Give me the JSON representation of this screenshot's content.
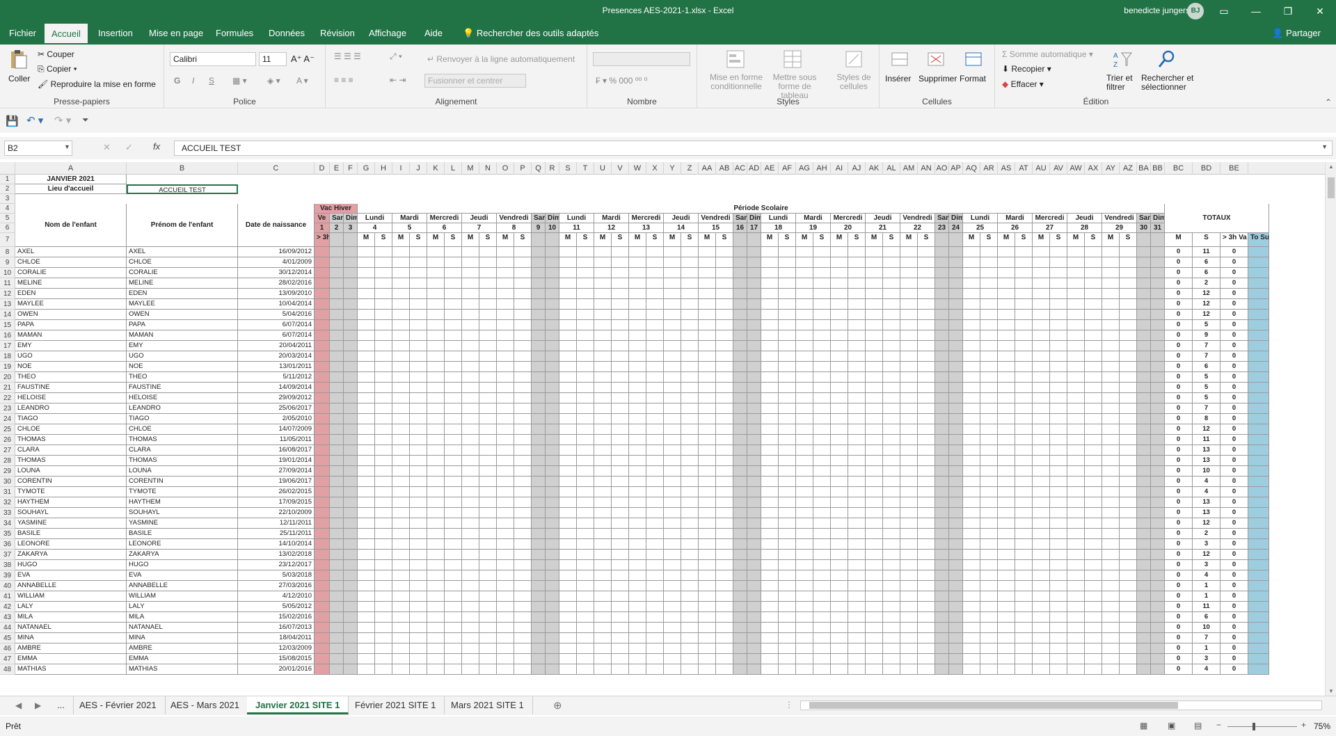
{
  "window": {
    "title": "Presences AES-2021-1.xlsx  -  Excel",
    "user": "benedicte jungers",
    "avatar_initials": "BJ"
  },
  "ribbon_tabs": [
    "Fichier",
    "Accueil",
    "Insertion",
    "Mise en page",
    "Formules",
    "Données",
    "Révision",
    "Affichage",
    "Aide",
    "Rechercher des outils adaptés"
  ],
  "share_label": "Partager",
  "ribbon": {
    "clipboard": {
      "paste": "Coller",
      "cut": "Couper",
      "copy": "Copier",
      "format_painter": "Reproduire la mise en forme",
      "label": "Presse-papiers"
    },
    "font": {
      "family": "Calibri",
      "size": "11",
      "label": "Police"
    },
    "alignment": {
      "wrap": "Renvoyer à la ligne automatiquement",
      "merge": "Fusionner et centrer",
      "label": "Alignement"
    },
    "number": {
      "label": "Nombre"
    },
    "styles": {
      "conditional": "Mise en forme conditionnelle",
      "table": "Mettre sous forme de tableau",
      "cell_styles": "Styles de cellules",
      "label": "Styles"
    },
    "cells": {
      "insert": "Insérer",
      "delete": "Supprimer",
      "format": "Format",
      "label": "Cellules"
    },
    "editing": {
      "autosum": "Somme automatique",
      "fill": "Recopier",
      "clear": "Effacer",
      "sort": "Trier et filtrer",
      "find": "Rechercher et sélectionner",
      "label": "Édition"
    }
  },
  "formula_bar": {
    "name_box": "B2",
    "formula": "ACCUEIL TEST"
  },
  "sheet": {
    "title": "JANVIER 2021",
    "place_label": "Lieu d'accueil",
    "place_value": "ACCUEIL TEST",
    "vac_label": "Vac Hiver",
    "period_label": "Période Scolaire",
    "totals_label": "TOTAUX",
    "col_name": "Nom de l'enfant",
    "col_firstname": "Prénom de l'enfant",
    "col_birth": "Date de naissance",
    "ve1": "Ve",
    "ve1num": "1",
    "over3h": "> 3h",
    "sam2": "Sam",
    "dim3": "Dim",
    "weeks": [
      {
        "days": [
          [
            "Lundi",
            "4"
          ],
          [
            "Mardi",
            "5"
          ],
          [
            "Mercredi",
            "6"
          ],
          [
            "Jeudi",
            "7"
          ],
          [
            "Vendredi",
            "8"
          ]
        ],
        "sat": [
          "Sam",
          "9"
        ],
        "sun": [
          "Dim",
          "10"
        ]
      },
      {
        "days": [
          [
            "Lundi",
            "11"
          ],
          [
            "Mardi",
            "12"
          ],
          [
            "Mercredi",
            "13"
          ],
          [
            "Jeudi",
            "14"
          ],
          [
            "Vendredi",
            "15"
          ]
        ],
        "sat": [
          "Sam",
          "16"
        ],
        "sun": [
          "Dim",
          "17"
        ]
      },
      {
        "days": [
          [
            "Lundi",
            "18"
          ],
          [
            "Mardi",
            "19"
          ],
          [
            "Mercredi",
            "20"
          ],
          [
            "Jeudi",
            "21"
          ],
          [
            "Vendredi",
            "22"
          ]
        ],
        "sat": [
          "Sam",
          "23"
        ],
        "sun": [
          "Dim",
          "24"
        ]
      },
      {
        "days": [
          [
            "Lundi",
            "25"
          ],
          [
            "Mardi",
            "26"
          ],
          [
            "Mercredi",
            "27"
          ],
          [
            "Jeudi",
            "28"
          ],
          [
            "Vendredi",
            "29"
          ]
        ],
        "sat": [
          "Sam",
          "30"
        ],
        "sun": [
          "Dim",
          "31"
        ]
      }
    ],
    "tot_headers": [
      "M",
      "S",
      "> 3h Va",
      "To Subsi"
    ],
    "col_letters": [
      "A",
      "B",
      "C",
      "D",
      "E",
      "F",
      "G",
      "H",
      "I",
      "J",
      "K",
      "L",
      "M",
      "N",
      "O",
      "P",
      "Q",
      "R",
      "S",
      "T",
      "U",
      "V",
      "W",
      "X",
      "Y",
      "Z",
      "AA",
      "AB",
      "AC",
      "AD",
      "AE",
      "AF",
      "AG",
      "AH",
      "AI",
      "AJ",
      "AK",
      "AL",
      "AM",
      "AN",
      "AO",
      "AP",
      "AQ",
      "AR",
      "AS",
      "AT",
      "AU",
      "AV",
      "AW",
      "AX",
      "AY",
      "AZ",
      "BA",
      "BB",
      "BC",
      "BD",
      "BE"
    ],
    "children": [
      {
        "row": "8",
        "name": "AXEL",
        "first": "AXEL",
        "birth": "16/09/2012",
        "m": "0",
        "s": "11",
        "o": "0"
      },
      {
        "row": "9",
        "name": "CHLOE",
        "first": "CHLOE",
        "birth": "4/01/2009",
        "m": "0",
        "s": "6",
        "o": "0"
      },
      {
        "row": "10",
        "name": "CORALIE",
        "first": "CORALIE",
        "birth": "30/12/2014",
        "m": "0",
        "s": "6",
        "o": "0"
      },
      {
        "row": "11",
        "name": "MELINE",
        "first": "MELINE",
        "birth": "28/02/2016",
        "m": "0",
        "s": "2",
        "o": "0"
      },
      {
        "row": "12",
        "name": "EDEN",
        "first": "EDEN",
        "birth": "13/09/2010",
        "m": "0",
        "s": "12",
        "o": "0"
      },
      {
        "row": "13",
        "name": "MAYLEE",
        "first": "MAYLEE",
        "birth": "10/04/2014",
        "m": "0",
        "s": "12",
        "o": "0"
      },
      {
        "row": "14",
        "name": "OWEN",
        "first": "OWEN",
        "birth": "5/04/2016",
        "m": "0",
        "s": "12",
        "o": "0"
      },
      {
        "row": "15",
        "name": "PAPA",
        "first": "PAPA",
        "birth": "6/07/2014",
        "m": "0",
        "s": "5",
        "o": "0"
      },
      {
        "row": "16",
        "name": "MAMAN",
        "first": "MAMAN",
        "birth": "6/07/2014",
        "m": "0",
        "s": "9",
        "o": "0"
      },
      {
        "row": "17",
        "name": "EMY",
        "first": "EMY",
        "birth": "20/04/2011",
        "m": "0",
        "s": "7",
        "o": "0"
      },
      {
        "row": "18",
        "name": "UGO",
        "first": "UGO",
        "birth": "20/03/2014",
        "m": "0",
        "s": "7",
        "o": "0"
      },
      {
        "row": "19",
        "name": "NOE",
        "first": "NOE",
        "birth": "13/01/2011",
        "m": "0",
        "s": "6",
        "o": "0"
      },
      {
        "row": "20",
        "name": "THEO",
        "first": "THEO",
        "birth": "5/11/2012",
        "m": "0",
        "s": "5",
        "o": "0"
      },
      {
        "row": "21",
        "name": "FAUSTINE",
        "first": "FAUSTINE",
        "birth": "14/09/2014",
        "m": "0",
        "s": "5",
        "o": "0"
      },
      {
        "row": "22",
        "name": "HELOISE",
        "first": "HELOISE",
        "birth": "29/09/2012",
        "m": "0",
        "s": "5",
        "o": "0"
      },
      {
        "row": "23",
        "name": "LEANDRO",
        "first": "LEANDRO",
        "birth": "25/06/2017",
        "m": "0",
        "s": "7",
        "o": "0"
      },
      {
        "row": "24",
        "name": "TIAGO",
        "first": "TIAGO",
        "birth": "2/05/2010",
        "m": "0",
        "s": "8",
        "o": "0"
      },
      {
        "row": "25",
        "name": "CHLOE",
        "first": "CHLOE",
        "birth": "14/07/2009",
        "m": "0",
        "s": "12",
        "o": "0"
      },
      {
        "row": "26",
        "name": "THOMAS",
        "first": "THOMAS",
        "birth": "11/05/2011",
        "m": "0",
        "s": "11",
        "o": "0"
      },
      {
        "row": "27",
        "name": "CLARA",
        "first": "CLARA",
        "birth": "16/08/2017",
        "m": "0",
        "s": "13",
        "o": "0"
      },
      {
        "row": "28",
        "name": "THOMAS",
        "first": "THOMAS",
        "birth": "19/01/2014",
        "m": "0",
        "s": "13",
        "o": "0"
      },
      {
        "row": "29",
        "name": "LOUNA",
        "first": "LOUNA",
        "birth": "27/09/2014",
        "m": "0",
        "s": "10",
        "o": "0"
      },
      {
        "row": "30",
        "name": "CORENTIN",
        "first": "CORENTIN",
        "birth": "19/06/2017",
        "m": "0",
        "s": "4",
        "o": "0"
      },
      {
        "row": "31",
        "name": "TYMOTE",
        "first": "TYMOTE",
        "birth": "26/02/2015",
        "m": "0",
        "s": "4",
        "o": "0"
      },
      {
        "row": "32",
        "name": "HAYTHEM",
        "first": "HAYTHEM",
        "birth": "17/09/2015",
        "m": "0",
        "s": "13",
        "o": "0"
      },
      {
        "row": "33",
        "name": "SOUHAYL",
        "first": "SOUHAYL",
        "birth": "22/10/2009",
        "m": "0",
        "s": "13",
        "o": "0"
      },
      {
        "row": "34",
        "name": "YASMINE",
        "first": "YASMINE",
        "birth": "12/11/2011",
        "m": "0",
        "s": "12",
        "o": "0"
      },
      {
        "row": "35",
        "name": "BASILE",
        "first": "BASILE",
        "birth": "25/11/2011",
        "m": "0",
        "s": "2",
        "o": "0"
      },
      {
        "row": "36",
        "name": "LEONORE",
        "first": "LEONORE",
        "birth": "14/10/2014",
        "m": "0",
        "s": "3",
        "o": "0"
      },
      {
        "row": "37",
        "name": "ZAKARYA",
        "first": "ZAKARYA",
        "birth": "13/02/2018",
        "m": "0",
        "s": "12",
        "o": "0"
      },
      {
        "row": "38",
        "name": "HUGO",
        "first": "HUGO",
        "birth": "23/12/2017",
        "m": "0",
        "s": "3",
        "o": "0"
      },
      {
        "row": "39",
        "name": "EVA",
        "first": "EVA",
        "birth": "5/03/2018",
        "m": "0",
        "s": "4",
        "o": "0"
      },
      {
        "row": "40",
        "name": "ANNABELLE",
        "first": "ANNABELLE",
        "birth": "27/03/2016",
        "m": "0",
        "s": "1",
        "o": "0"
      },
      {
        "row": "41",
        "name": "WILLIAM",
        "first": "WILLIAM",
        "birth": "4/12/2010",
        "m": "0",
        "s": "1",
        "o": "0"
      },
      {
        "row": "42",
        "name": "LALY",
        "first": "LALY",
        "birth": "5/05/2012",
        "m": "0",
        "s": "11",
        "o": "0"
      },
      {
        "row": "43",
        "name": "MILA",
        "first": "MILA",
        "birth": "15/02/2016",
        "m": "0",
        "s": "6",
        "o": "0"
      },
      {
        "row": "44",
        "name": "NATANAEL",
        "first": "NATANAEL",
        "birth": "16/07/2013",
        "m": "0",
        "s": "10",
        "o": "0"
      },
      {
        "row": "45",
        "name": "MINA",
        "first": "MINA",
        "birth": "18/04/2011",
        "m": "0",
        "s": "7",
        "o": "0"
      },
      {
        "row": "46",
        "name": "AMBRE",
        "first": "AMBRE",
        "birth": "12/03/2009",
        "m": "0",
        "s": "1",
        "o": "0"
      },
      {
        "row": "47",
        "name": "EMMA",
        "first": "EMMA",
        "birth": "15/08/2015",
        "m": "0",
        "s": "3",
        "o": "0"
      },
      {
        "row": "48",
        "name": "MATHIAS",
        "first": "MATHIAS",
        "birth": "20/01/2016",
        "m": "0",
        "s": "4",
        "o": "0"
      }
    ]
  },
  "sheet_tabs": [
    "...",
    "AES - Février 2021",
    "AES - Mars 2021",
    "Janvier 2021 SITE 1",
    "Février 2021 SITE 1",
    "Mars 2021 SITE 1"
  ],
  "active_sheet_index": 3,
  "status": {
    "ready": "Prêt",
    "zoom": "75%"
  },
  "colors": {
    "accent": "#217346",
    "vac": "#e0a0a4",
    "weekend": "#d0d0d0",
    "totals": "#9fcde0"
  }
}
